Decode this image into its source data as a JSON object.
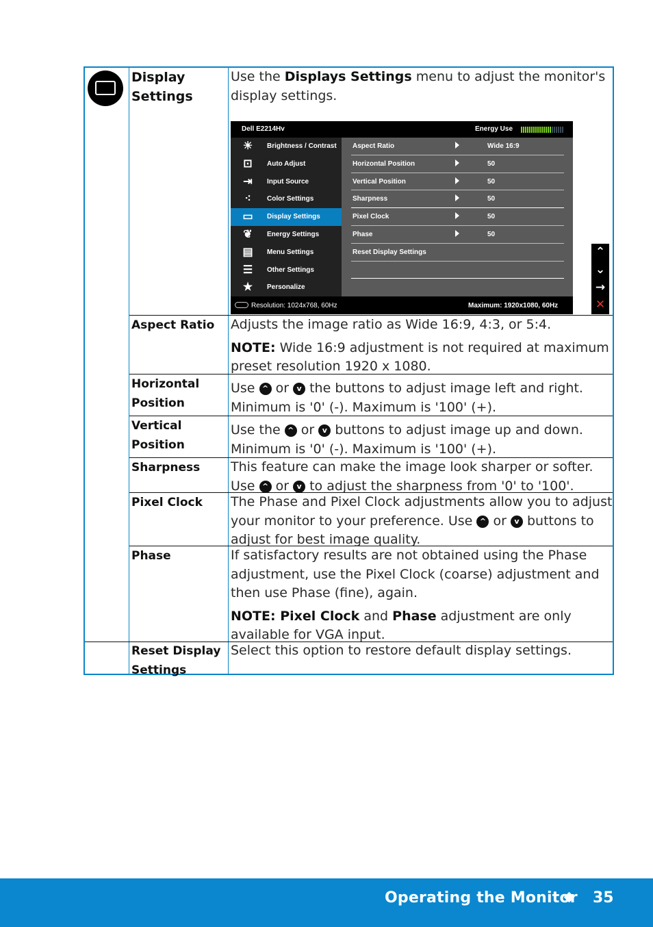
{
  "section": {
    "icon": "display-settings-icon",
    "label": "Display Settings",
    "intro_prefix": "Use the ",
    "intro_bold": "Displays Settings",
    "intro_suffix": " menu to adjust the monitor's display settings."
  },
  "osd": {
    "model": "Dell E2214Hv",
    "energy_label": "Energy Use",
    "energy_level_segments": 15,
    "energy_total_segments": 21,
    "menu_items": [
      {
        "icon": "brightness-icon",
        "glyph": "☀",
        "label": "Brightness / Contrast"
      },
      {
        "icon": "auto-adjust-icon",
        "glyph": "⊡",
        "label": "Auto Adjust"
      },
      {
        "icon": "input-source-icon",
        "glyph": "⇥",
        "label": "Input Source"
      },
      {
        "icon": "color-settings-icon",
        "glyph": "⁖",
        "label": "Color Settings"
      },
      {
        "icon": "display-settings-icon",
        "glyph": "▭",
        "label": "Display Settings",
        "active": true
      },
      {
        "icon": "energy-leaf-icon",
        "glyph": "❦",
        "label": "Energy Settings"
      },
      {
        "icon": "menu-settings-icon",
        "glyph": "▤",
        "label": "Menu Settings"
      },
      {
        "icon": "other-settings-icon",
        "glyph": "☰",
        "label": "Other Settings"
      },
      {
        "icon": "star-icon",
        "glyph": "★",
        "label": "Personalize"
      }
    ],
    "sub_items": [
      {
        "label": "Aspect Ratio",
        "value": "Wide 16:9",
        "arrow": true
      },
      {
        "label": "Horizontal Position",
        "value": "50",
        "arrow": true
      },
      {
        "label": "Vertical Position",
        "value": "50",
        "arrow": true
      },
      {
        "label": "Sharpness",
        "value": "50",
        "arrow": true
      },
      {
        "label": "Pixel Clock",
        "value": "50",
        "arrow": true
      },
      {
        "label": "Phase",
        "value": "50",
        "arrow": true
      },
      {
        "label": "Reset Display Settings",
        "value": "",
        "arrow": false
      },
      {
        "label": "",
        "value": "",
        "arrow": false
      }
    ],
    "resolution": "Resolution: 1024x768,  60Hz",
    "maximum": "Maximum: 1920x1080,  60Hz",
    "nav_buttons": [
      {
        "icon": "up-chevron-icon",
        "glyph": "⌃"
      },
      {
        "icon": "down-chevron-icon",
        "glyph": "⌄"
      },
      {
        "icon": "right-arrow-icon",
        "glyph": "→"
      },
      {
        "icon": "close-icon",
        "glyph": "✕"
      }
    ]
  },
  "rows": [
    {
      "label": "Aspect Ratio",
      "text": "Adjusts the image ratio as Wide 16:9, 4:3, or 5:4.",
      "note_bold": "NOTE:",
      "note_text": " Wide 16:9 adjustment is not required at maximum preset resolution  1920 x 1080."
    },
    {
      "label": "Horizontal Position",
      "p1": "Use ",
      "p2": " or ",
      "p3": " the buttons to adjust image left and right.",
      "p4": "Minimum is '0' (-). Maximum is '100' (+)."
    },
    {
      "label": "Vertical Position",
      "p1": "Use the ",
      "p2": " or ",
      "p3": " buttons to adjust image up and down.",
      "p4": "Minimum is '0' (-). Maximum is '100' (+)."
    },
    {
      "label": "Sharpness",
      "p1": "This feature can make the image look sharper or softer. Use ",
      "p2": " or ",
      "p3": " to adjust the sharpness from '0' to '100'."
    },
    {
      "label": "Pixel Clock",
      "p1": "The Phase and Pixel Clock adjustments allow you to adjust your monitor to your preference. Use ",
      "p2": " or ",
      "p3": " buttons to adjust for best image quality."
    },
    {
      "label": "Phase",
      "text": "If satisfactory results are not obtained using the Phase adjustment, use the Pixel Clock (coarse) adjustment and then use Phase (fine), again.",
      "note_bold1": "NOTE: Pixel Clock",
      "note_mid": " and ",
      "note_bold2": "Phase",
      "note_text": " adjustment are only available for VGA input."
    },
    {
      "label": "Reset Display Settings",
      "text": "Select this option to restore default display settings."
    }
  ],
  "button_icons": {
    "up": "^",
    "down": "v"
  },
  "footer": {
    "title": "Operating the Monitor",
    "separator_icon": "diamond-icon",
    "page": "35"
  }
}
